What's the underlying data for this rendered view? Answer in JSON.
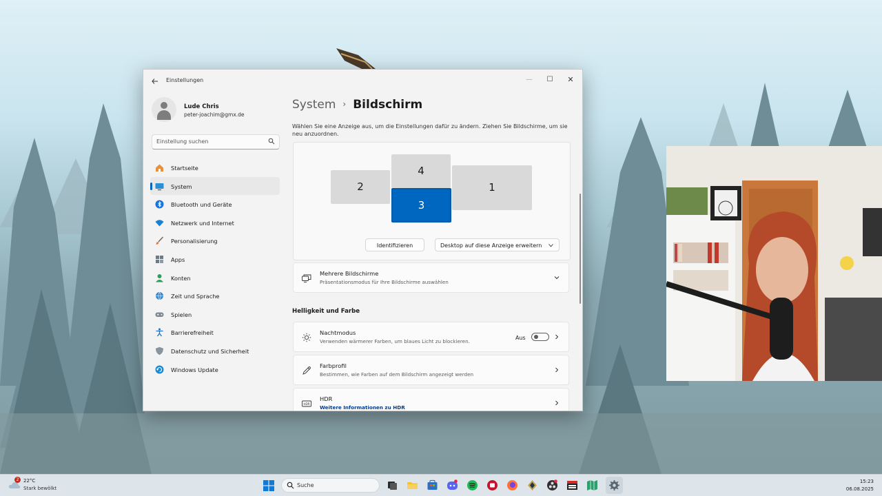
{
  "window": {
    "app_title": "Einstellungen",
    "controls": {
      "minimize": "—",
      "maximize": "☐",
      "close": "✕"
    }
  },
  "profile": {
    "name": "Lude Chris",
    "email": "peter-joachim@gmx.de"
  },
  "search": {
    "placeholder": "Einstellung suchen"
  },
  "nav": {
    "items": [
      {
        "label": "Startseite",
        "icon": "home-icon"
      },
      {
        "label": "System",
        "icon": "monitor-icon",
        "active": true
      },
      {
        "label": "Bluetooth und Geräte",
        "icon": "bluetooth-icon"
      },
      {
        "label": "Netzwerk und Internet",
        "icon": "wifi-icon"
      },
      {
        "label": "Personalisierung",
        "icon": "brush-icon"
      },
      {
        "label": "Apps",
        "icon": "apps-icon"
      },
      {
        "label": "Konten",
        "icon": "account-icon"
      },
      {
        "label": "Zeit und Sprache",
        "icon": "globe-clock-icon"
      },
      {
        "label": "Spielen",
        "icon": "gamepad-icon"
      },
      {
        "label": "Barrierefreiheit",
        "icon": "accessibility-icon"
      },
      {
        "label": "Datenschutz und Sicherheit",
        "icon": "shield-icon"
      },
      {
        "label": "Windows Update",
        "icon": "update-icon"
      }
    ]
  },
  "content": {
    "breadcrumb_parent": "System",
    "breadcrumb_sep": "›",
    "breadcrumb_current": "Bildschirm",
    "description": "Wählen Sie eine Anzeige aus, um die Einstellungen dafür zu ändern. Ziehen Sie Bildschirme, um sie neu anzuordnen.",
    "monitors": [
      {
        "label": "2",
        "selected": false
      },
      {
        "label": "4",
        "selected": false
      },
      {
        "label": "3",
        "selected": true
      },
      {
        "label": "1",
        "selected": false
      }
    ],
    "identify_button": "Identifizieren",
    "extend_dropdown": "Desktop auf diese Anzeige erweitern",
    "multiple_displays": {
      "title": "Mehrere Bildschirme",
      "subtitle": "Präsentationsmodus für Ihre Bildschirme auswählen"
    },
    "section_brightness": "Helligkeit und Farbe",
    "night_mode": {
      "title": "Nachtmodus",
      "subtitle": "Verwenden wärmerer Farben, um blaues Licht zu blockieren.",
      "state": "Aus"
    },
    "color_profile": {
      "title": "Farbprofil",
      "subtitle": "Bestimmen, wie Farben auf dem Bildschirm angezeigt werden"
    },
    "hdr": {
      "title": "HDR",
      "link": "Weitere Informationen zu HDR"
    }
  },
  "taskbar": {
    "weather_badge": "2",
    "weather_temp": "22°C",
    "weather_desc": "Stark bewölkt",
    "search_label": "Suche",
    "clock_time": "15:23",
    "clock_date": "06.08.2025"
  },
  "colors": {
    "accent": "#0067c0",
    "selected_monitor": "#0067c0"
  }
}
